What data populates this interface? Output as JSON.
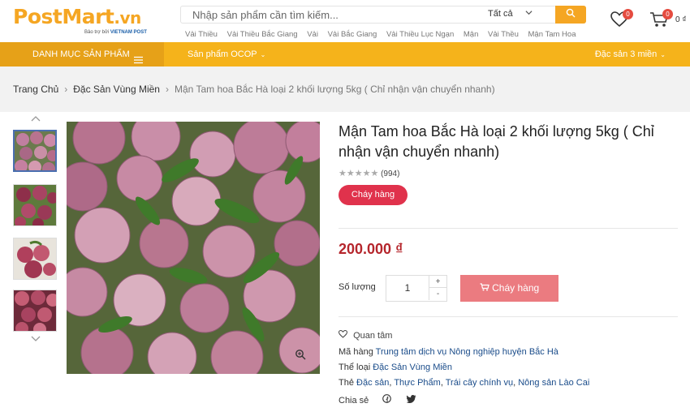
{
  "header": {
    "logo_main": "PostMart",
    "logo_vn": ".vn",
    "logo_sub_small": "Bảo trợ bởi",
    "logo_sub_brand": "VIETNAM POST",
    "search_placeholder": "Nhập sản phẩm cần tìm kiếm...",
    "search_category": "Tất cả",
    "keywords": [
      "Vải Thiều",
      "Vải Thiều Bắc Giang",
      "Vải",
      "Vải Bắc Giang",
      "Vải Thiều Lục Ngạn",
      "Mận",
      "Vải Thều",
      "Mận Tam Hoa"
    ],
    "wishlist_count": "0",
    "cart_count": "0",
    "cart_total": "0 ₫"
  },
  "nav": {
    "categories_label": "DANH MỤC SẢN PHẨM",
    "ocop_label": "Sản phẩm OCOP",
    "regional_label": "Đặc sản 3 miền"
  },
  "breadcrumb": {
    "home": "Trang Chủ",
    "category": "Đặc Sản Vùng Miền",
    "current": "Mận Tam hoa Bắc Hà loại 2 khối lượng 5kg ( Chỉ nhận vận chuyển nhanh)"
  },
  "product": {
    "title": "Mận Tam hoa Bắc Hà loại 2 khối lượng 5kg ( Chỉ nhận vận chuyển nhanh)",
    "rating_stars": 0,
    "review_count": "(994)",
    "status_badge": "Cháy hàng",
    "price": "200.000 ₫",
    "quantity_label": "Số lượng",
    "quantity": "1",
    "buy_label": "Cháy hàng",
    "favorite_label": "Quan tâm",
    "sku_label": "Mã hàng",
    "sku_value": "Trung tâm dịch vụ Nông nghiệp huyện Bắc Hà",
    "category_label": "Thể loại",
    "category_value": "Đặc Sản Vùng Miền",
    "tags_label": "Thẻ",
    "tags": [
      "Đặc sản",
      "Thực Phẩm",
      "Trái cây chính vụ",
      "Nông sản Lào Cai"
    ],
    "share_label": "Chia sẻ"
  },
  "colors": {
    "brand": "#f5a623",
    "navbar": "#f5b31b",
    "price": "#b5262c",
    "badge": "#e0324c",
    "buy_button": "#eb7b80",
    "link": "#1a4c8a"
  }
}
